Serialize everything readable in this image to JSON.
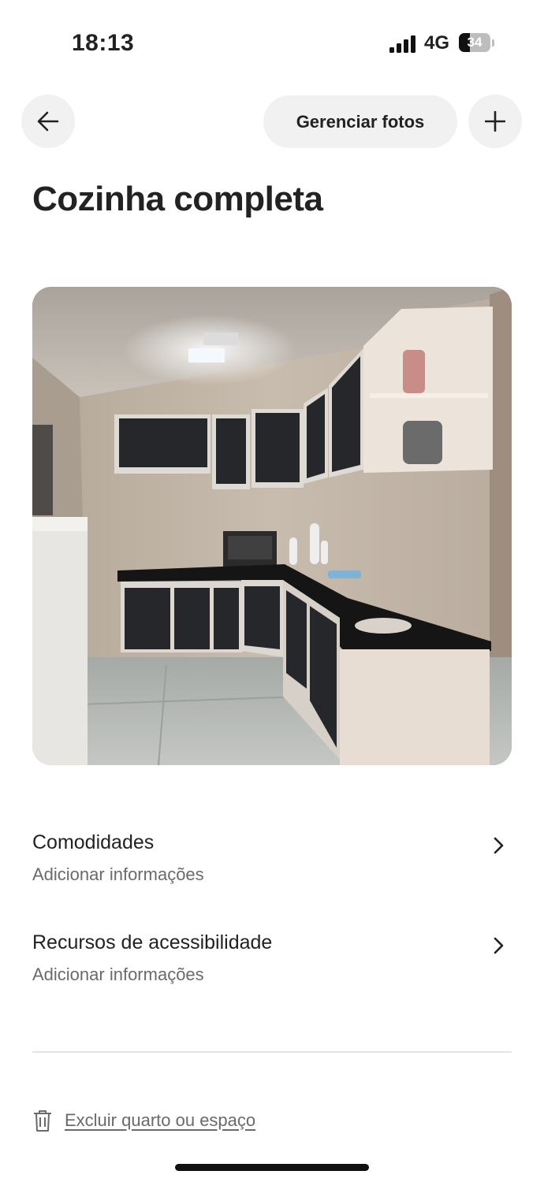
{
  "status_bar": {
    "time": "18:13",
    "network": "4G",
    "battery_level": "34",
    "battery_fraction": 0.34
  },
  "header": {
    "back_icon": "arrow-left-icon",
    "manage_photos_label": "Gerenciar fotos",
    "add_icon": "plus-icon"
  },
  "page": {
    "title": "Cozinha completa"
  },
  "photo": {
    "description": "Kitchen photo with black countertops and glass-panel cabinets"
  },
  "sections": [
    {
      "title": "Comodidades",
      "subtitle": "Adicionar informações",
      "icon": "chevron-right-icon"
    },
    {
      "title": "Recursos de acessibilidade",
      "subtitle": "Adicionar informações",
      "icon": "chevron-right-icon"
    }
  ],
  "footer": {
    "delete_label": "Excluir quarto ou espaço",
    "delete_icon": "trash-icon"
  },
  "colors": {
    "text": "#222222",
    "muted": "#6a6a6a",
    "button_bg": "#f1f1f1",
    "divider": "#e4e4e4"
  }
}
